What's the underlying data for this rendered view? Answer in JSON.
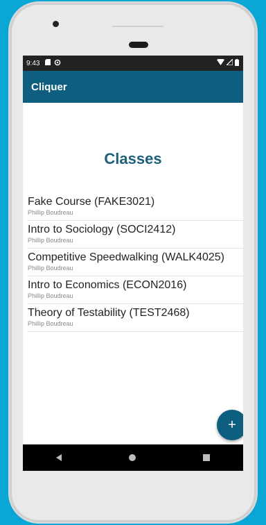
{
  "status_bar": {
    "time": "9:43",
    "icons": [
      "sd-card-icon",
      "sync-icon",
      "wifi-icon",
      "signal-icon",
      "battery-icon"
    ]
  },
  "app_bar": {
    "title": "Cliquer"
  },
  "main": {
    "title": "Classes",
    "classes": [
      {
        "name": "Fake Course (FAKE3021)",
        "instructor": "Phillip Boudreau"
      },
      {
        "name": "Intro to Sociology (SOCI2412)",
        "instructor": "Phillip Boudreau"
      },
      {
        "name": "Competitive Speedwalking (WALK4025)",
        "instructor": "Phillip Boudreau"
      },
      {
        "name": "Intro to Economics (ECON2016)",
        "instructor": "Phillip Boudreau"
      },
      {
        "name": "Theory of Testability (TEST2468)",
        "instructor": "Phillip Boudreau"
      }
    ]
  },
  "fab": {
    "label": "+"
  },
  "colors": {
    "app_bar": "#0e5f7f",
    "title": "#1c5f7a",
    "background": "#0aa6d6"
  }
}
